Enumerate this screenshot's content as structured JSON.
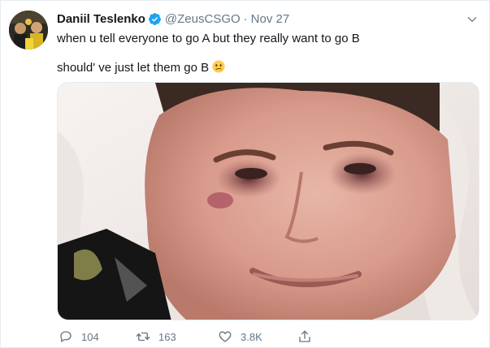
{
  "tweet": {
    "author_name": "Daniil Teslenko",
    "handle": "@ZeusCSGO",
    "separator": "·",
    "date": "Nov 27",
    "line1": "when u tell everyone to go A but they really want to go B",
    "line2": "should'   ve just let them go B",
    "emoji": "confused-face-emoji",
    "verified_icon": "verified-badge-icon",
    "media_description": ""
  },
  "actions": {
    "replies": "104",
    "retweets": "163",
    "likes": "3.8K"
  },
  "colors": {
    "text": "#14171a",
    "secondary": "#657786",
    "verified": "#1da1f2",
    "border": "#e6ecf0"
  }
}
